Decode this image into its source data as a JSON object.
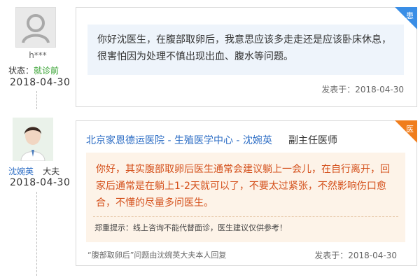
{
  "patient": {
    "username": "h***",
    "status_label": "状态：",
    "status_value": "就诊前",
    "date": "2018-04-30"
  },
  "question": {
    "ribbon": "患",
    "text": "你好沈医生，在腹部取卵后，我意思应该多走走还是应该卧床休息，很害怕因为处理不慎出现出血、腹水等问题。",
    "posted_label": "发表于：",
    "posted_date": "2018-04-30"
  },
  "doctor": {
    "name": "沈婉英",
    "suffix": "大夫",
    "date": "2018-04-30"
  },
  "answer": {
    "ribbon": "医",
    "hospital": "北京家恩德运医院",
    "sep1": " - ",
    "department": "生殖医学中心",
    "sep2": " - ",
    "doctor_name": "沈婉英",
    "doctor_title": "副主任医师",
    "text": "你好，其实腹部取卵后医生通常会建议躺上一会儿，在自行离开，回家后通常是在躺上1-2天就可以了，不要太过紧张，不然影响伤口愈合，不懂的尽量多问医生。",
    "note": "郑重提示：线上咨询不能代替面诊，医生建议仅供参考！",
    "footer": "“腹部取卵后”问题由沈婉英大夫本人回复",
    "posted_label": "发表于：",
    "posted_date": "2018-04-30"
  },
  "colors": {
    "ribbon_blue": "#3a8ee6",
    "ribbon_orange": "#f07d1c",
    "link_blue": "#2b6cc4",
    "answer_text": "#d4501b",
    "status_green": "#32a02d"
  }
}
